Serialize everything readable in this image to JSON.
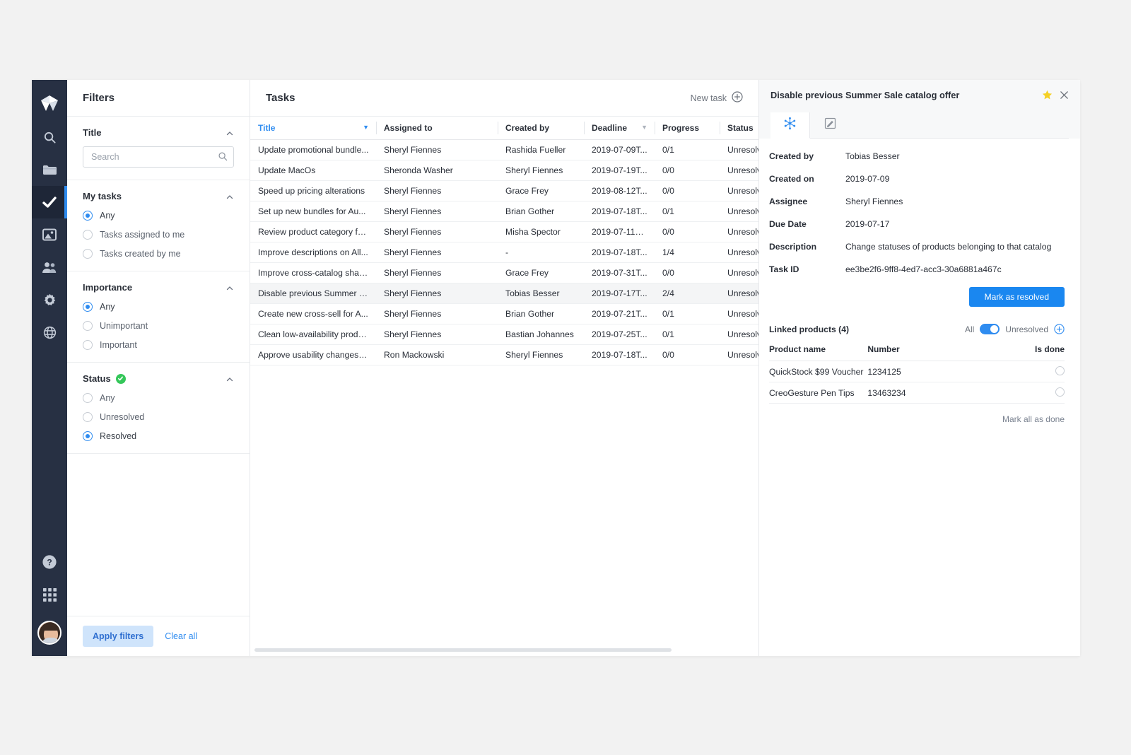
{
  "rail": {
    "logo_icon": "app-logo-icon",
    "items": [
      {
        "id": "search",
        "icon": "search-icon",
        "active": false
      },
      {
        "id": "files",
        "icon": "folder-icon",
        "active": false
      },
      {
        "id": "tasks",
        "icon": "check-icon",
        "active": true
      },
      {
        "id": "media",
        "icon": "image-icon",
        "active": false
      },
      {
        "id": "users",
        "icon": "users-icon",
        "active": false
      },
      {
        "id": "settings",
        "icon": "gear-icon",
        "active": false
      },
      {
        "id": "globe",
        "icon": "globe-icon",
        "active": false
      }
    ],
    "bottom": [
      {
        "id": "help",
        "icon": "help-circle-icon"
      },
      {
        "id": "apps",
        "icon": "grid-apps-icon"
      }
    ],
    "avatar_name": "user-avatar"
  },
  "filters": {
    "heading": "Filters",
    "title_group": {
      "label": "Title",
      "search_placeholder": "Search",
      "search_value": ""
    },
    "my_tasks": {
      "label": "My tasks",
      "options": [
        {
          "label": "Any",
          "selected": true
        },
        {
          "label": "Tasks assigned to me",
          "selected": false
        },
        {
          "label": "Tasks created by me",
          "selected": false
        }
      ]
    },
    "importance": {
      "label": "Importance",
      "options": [
        {
          "label": "Any",
          "selected": true
        },
        {
          "label": "Unimportant",
          "selected": false
        },
        {
          "label": "Important",
          "selected": false
        }
      ]
    },
    "status": {
      "label": "Status",
      "badge_icon": "check-circle-green-icon",
      "options": [
        {
          "label": "Any",
          "selected": false
        },
        {
          "label": "Unresolved",
          "selected": false
        },
        {
          "label": "Resolved",
          "selected": true
        }
      ]
    },
    "apply_label": "Apply filters",
    "clear_label": "Clear all"
  },
  "tasks_panel": {
    "heading": "Tasks",
    "new_task_label": "New task",
    "new_task_icon": "plus-circle-icon",
    "columns": [
      {
        "key": "title",
        "label": "Title",
        "sorted": true,
        "caret": "▼"
      },
      {
        "key": "assigned",
        "label": "Assigned to",
        "sorted": false,
        "caret": ""
      },
      {
        "key": "created",
        "label": "Created by",
        "sorted": false,
        "caret": ""
      },
      {
        "key": "deadline",
        "label": "Deadline",
        "sorted": false,
        "caret": "▼"
      },
      {
        "key": "progress",
        "label": "Progress",
        "sorted": false,
        "caret": ""
      },
      {
        "key": "status",
        "label": "Status",
        "sorted": false,
        "caret": ""
      }
    ],
    "rows": [
      {
        "title": "Update promotional bundle...",
        "assigned": "Sheryl Fiennes",
        "created": "Rashida Fueller",
        "deadline": "2019-07-09T...",
        "progress": "0/1",
        "status": "Unresolved",
        "selected": false
      },
      {
        "title": "Update MacOs",
        "assigned": "Sheronda Washer",
        "created": "Sheryl Fiennes",
        "deadline": "2019-07-19T...",
        "progress": "0/0",
        "status": "Unresolved",
        "selected": false
      },
      {
        "title": "Speed up pricing alterations",
        "assigned": "Sheryl Fiennes",
        "created": "Grace Frey",
        "deadline": "2019-08-12T...",
        "progress": "0/0",
        "status": "Unresolved",
        "selected": false
      },
      {
        "title": "Set up new bundles for Au...",
        "assigned": "Sheryl Fiennes",
        "created": "Brian Gother",
        "deadline": "2019-07-18T...",
        "progress": "0/1",
        "status": "Unresolved",
        "selected": false
      },
      {
        "title": "Review product category fe...",
        "assigned": "Sheryl Fiennes",
        "created": "Misha Spector",
        "deadline": "2019-07-11T0...",
        "progress": "0/0",
        "status": "Unresolved",
        "selected": false
      },
      {
        "title": "Improve descriptions on All...",
        "assigned": "Sheryl Fiennes",
        "created": "-",
        "deadline": "2019-07-18T...",
        "progress": "1/4",
        "status": "Unresolved",
        "selected": false
      },
      {
        "title": "Improve cross-catalog shari...",
        "assigned": "Sheryl Fiennes",
        "created": "Grace Frey",
        "deadline": "2019-07-31T...",
        "progress": "0/0",
        "status": "Unresolved",
        "selected": false
      },
      {
        "title": "Disable previous Summer S...",
        "assigned": "Sheryl Fiennes",
        "created": "Tobias Besser",
        "deadline": "2019-07-17T...",
        "progress": "2/4",
        "status": "Unresolved",
        "selected": true
      },
      {
        "title": "Create new cross-sell for A...",
        "assigned": "Sheryl Fiennes",
        "created": "Brian Gother",
        "deadline": "2019-07-21T...",
        "progress": "0/1",
        "status": "Unresolved",
        "selected": false
      },
      {
        "title": "Clean low-availability produ...",
        "assigned": "Sheryl Fiennes",
        "created": "Bastian Johannes",
        "deadline": "2019-07-25T...",
        "progress": "0/1",
        "status": "Unresolved",
        "selected": false
      },
      {
        "title": "Approve usability changes i...",
        "assigned": "Ron Mackowski",
        "created": "Sheryl Fiennes",
        "deadline": "2019-07-18T...",
        "progress": "0/0",
        "status": "Unresolved",
        "selected": false
      }
    ]
  },
  "detail": {
    "title": "Disable previous Summer Sale catalog offer",
    "star_icon": "star-filled-icon",
    "close_icon": "close-icon",
    "tabs": [
      {
        "id": "overview",
        "icon": "network-nodes-icon",
        "active": true
      },
      {
        "id": "notes",
        "icon": "note-edit-icon",
        "active": false
      }
    ],
    "fields": [
      {
        "label": "Created by",
        "value": "Tobias Besser"
      },
      {
        "label": "Created on",
        "value": "2019-07-09"
      },
      {
        "label": "Assignee",
        "value": "Sheryl Fiennes"
      },
      {
        "label": "Due Date",
        "value": "2019-07-17"
      },
      {
        "label": "Description",
        "value": "Change statuses of products belonging to that catalog"
      },
      {
        "label": "Task ID",
        "value": "ee3be2f6-9ff8-4ed7-acc3-30a6881a467c"
      }
    ],
    "resolve_label": "Mark as resolved",
    "linked": {
      "heading": "Linked products (4)",
      "toggle_left_label": "All",
      "toggle_right_label": "Unresolved",
      "toggle_on": true,
      "add_icon": "plus-circle-icon",
      "columns": [
        "Product name",
        "Number",
        "Is done"
      ],
      "rows": [
        {
          "name": "QuickStock $99 Voucher",
          "number": "1234125",
          "done": false
        },
        {
          "name": "CreoGesture Pen Tips",
          "number": "13463234",
          "done": false
        }
      ],
      "mark_all_label": "Mark all as done"
    }
  },
  "colors": {
    "accent": "#2f8cf0",
    "rail_bg": "#273043",
    "resolve_button": "#1a87f0",
    "star": "#f5d024",
    "status_green": "#35c75a"
  }
}
